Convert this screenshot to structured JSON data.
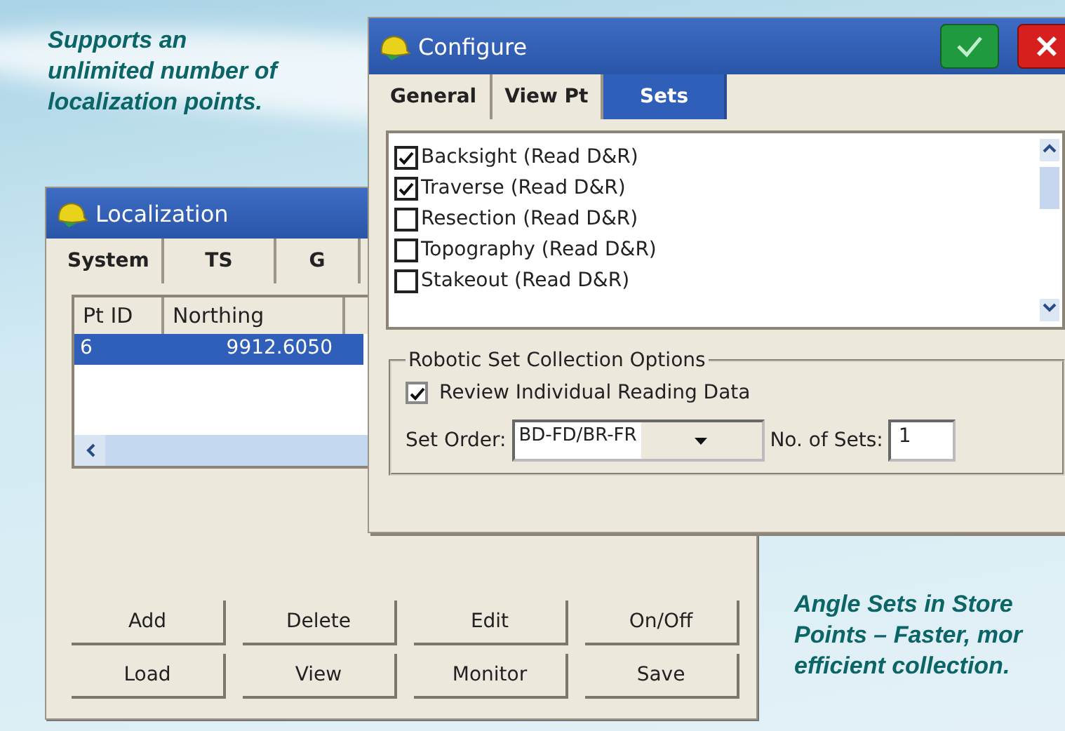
{
  "captions": [
    {
      "text": "Supports an\nunlimited number of\nlocalization points."
    },
    {
      "text": "Angle Sets in Store\nPoints – Faster, mor\nefficient collection."
    }
  ],
  "localization": {
    "title": "Localization",
    "tabs": [
      {
        "label": "System",
        "selected": false
      },
      {
        "label": "TS",
        "selected": false
      },
      {
        "label": "G",
        "selected": false
      }
    ],
    "table": {
      "columns": [
        "Pt ID",
        "Northing"
      ],
      "rows": [
        {
          "cells": [
            "6",
            "9912.6050"
          ],
          "selected": true
        }
      ]
    },
    "buttons": [
      [
        "Add",
        "Delete",
        "Edit",
        "On/Off"
      ],
      [
        "Load",
        "View",
        "Monitor",
        "Save"
      ]
    ]
  },
  "configure": {
    "title": "Configure",
    "tabs": [
      {
        "label": "General",
        "selected": false
      },
      {
        "label": "View Pt",
        "selected": false
      },
      {
        "label": "Sets",
        "selected": true
      }
    ],
    "sets": [
      {
        "label": "Backsight (Read D&R)",
        "checked": true
      },
      {
        "label": "Traverse (Read D&R)",
        "checked": true
      },
      {
        "label": "Resection (Read D&R)",
        "checked": false
      },
      {
        "label": "Topography (Read D&R)",
        "checked": false
      },
      {
        "label": "Stakeout (Read D&R)",
        "checked": false
      }
    ],
    "group": {
      "title": "Robotic Set Collection Options",
      "review": {
        "label": "Review Individual Reading Data",
        "checked": true
      },
      "set_order": {
        "label": "Set Order:",
        "value": "BD-FD/BR-FR"
      },
      "num_sets": {
        "label": "No. of Sets:",
        "value": "1"
      }
    }
  }
}
